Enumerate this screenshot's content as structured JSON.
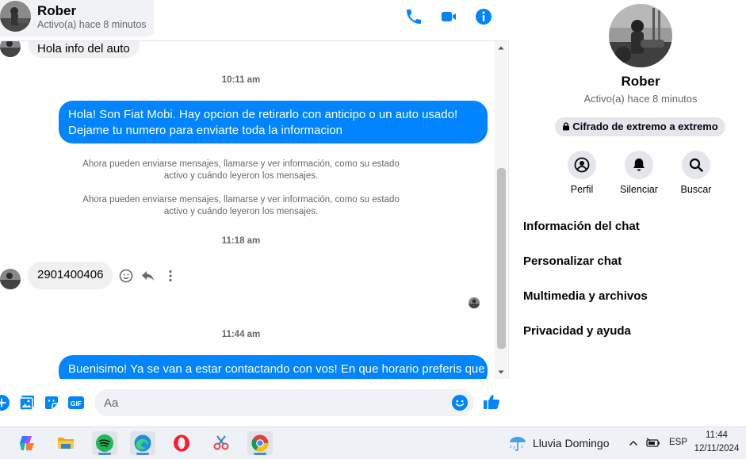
{
  "header": {
    "name": "Rober",
    "status": "Activo(a) hace 8 minutos"
  },
  "messages": {
    "top_incoming": "Hola info del auto",
    "time_1": "10:11 am",
    "outgoing_1_line1": "Hola! Son Fiat Mobi. Hay opcion de retirarlo con anticipo o un auto usado!",
    "outgoing_1_line2": "Dejame tu numero para enviarte toda la informacion",
    "system_1_line1": "Ahora pueden enviarse mensajes, llamarse y ver información, como su estado",
    "system_1_line2": "activo y cuándo leyeron los mensajes.",
    "system_2_line1": "Ahora pueden enviarse mensajes, llamarse y ver información, como su estado",
    "system_2_line2": "activo y cuándo leyeron los mensajes.",
    "time_2": "11:18 am",
    "incoming_number": "2901400406",
    "time_3": "11:44 am",
    "outgoing_2": "Buenisimo! Ya se van a estar contactando con vos! En que horario preferis que"
  },
  "composer": {
    "placeholder": "Aa"
  },
  "info": {
    "name": "Rober",
    "status": "Activo(a) hace 8 minutos",
    "encryption": "Cifrado de extremo a extremo",
    "actions": {
      "profile": "Perfil",
      "mute": "Silenciar",
      "search": "Buscar"
    },
    "rows": {
      "chat_info": "Información del chat",
      "customize": "Personalizar chat",
      "media": "Multimedia y archivos",
      "privacy": "Privacidad y ayuda"
    }
  },
  "taskbar": {
    "weather": "Lluvia Domingo",
    "language": "ESP",
    "time": "11:44",
    "date": "12/11/2024"
  },
  "colors": {
    "accent": "#0084ff",
    "bubble_in": "#f0f0f0",
    "muted_text": "#65676b"
  },
  "icons": [
    "phone-icon",
    "video-icon",
    "info-icon",
    "emoji-icon",
    "reply-icon",
    "more-icon",
    "plus-icon",
    "image-icon",
    "sticker-icon",
    "gif-icon",
    "like-icon",
    "lock-icon",
    "profile-icon",
    "bell-icon",
    "search-icon"
  ]
}
